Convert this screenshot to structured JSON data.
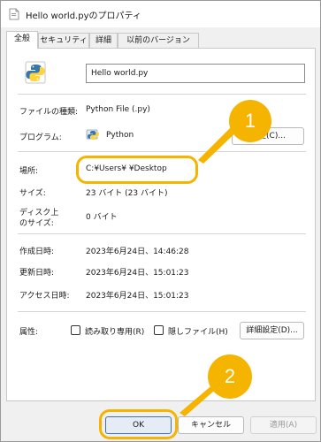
{
  "window": {
    "title": "Hello world.pyのプロパティ"
  },
  "tabs": [
    {
      "label": "全般"
    },
    {
      "label": "セキュリティ"
    },
    {
      "label": "詳細"
    },
    {
      "label": "以前のバージョン"
    }
  ],
  "file": {
    "name": "Hello world.py",
    "icon": "python-file-icon"
  },
  "rows": {
    "type_label": "ファイルの種類:",
    "type_value": "Python File (.py)",
    "program_label": "プログラム:",
    "program_value": "Python",
    "change_button": "変更(C)...",
    "location_label": "場所:",
    "location_value": "C:¥Users¥            ¥Desktop",
    "size_label": "サイズ:",
    "size_value": "23 バイト (23 バイト)",
    "disk_label_1": "ディスク上",
    "disk_label_2": "のサイズ:",
    "disk_value": "0 バイト",
    "created_label": "作成日時:",
    "created_value": "2023年6月24日、14:46:28",
    "modified_label": "更新日時:",
    "modified_value": "2023年6月24日、15:01:23",
    "accessed_label": "アクセス日時:",
    "accessed_value": "2023年6月24日、15:01:23",
    "attributes_label": "属性:",
    "readonly_label": "読み取り専用(R)",
    "hidden_label": "隠しファイル(H)",
    "advanced_button": "詳細設定(D)..."
  },
  "buttons": {
    "ok": "OK",
    "cancel": "キャンセル",
    "apply": "適用(A)"
  },
  "callouts": {
    "one": "1",
    "two": "2"
  },
  "colors": {
    "highlight": "#f5b400"
  }
}
